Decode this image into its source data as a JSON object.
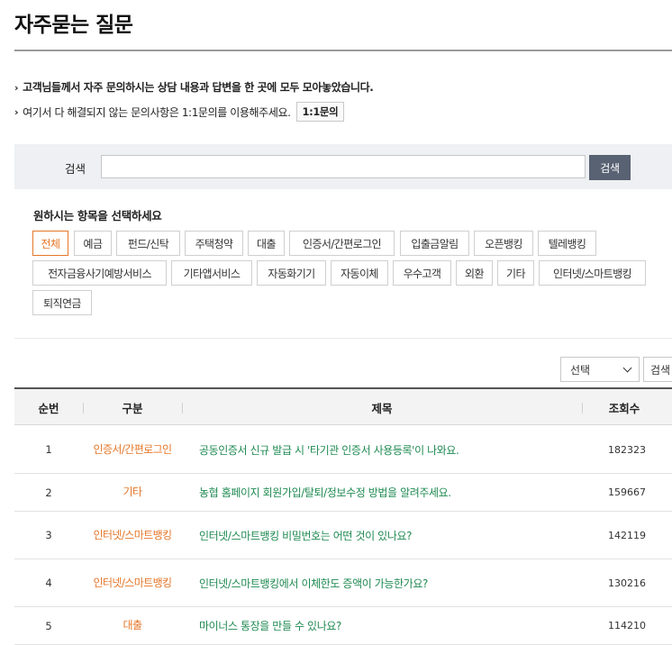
{
  "page": {
    "title": "자주묻는 질문"
  },
  "notices": [
    "고객님들께서 자주 문의하시는 상담 내용과 답변을 한 곳에 모두 모아놓았습니다.",
    "여기서 다 해결되지 않는 문의사항은 1:1문의를 이용해주세요."
  ],
  "inquiry_button": "1:1문의",
  "search": {
    "label": "검색",
    "value": "",
    "button": "검색"
  },
  "category_heading": "원하시는 항목을 선택하세요",
  "categories": [
    {
      "label": "전체",
      "active": true
    },
    {
      "label": "예금"
    },
    {
      "label": "펀드/신탁"
    },
    {
      "label": "주택청약"
    },
    {
      "label": "대출"
    },
    {
      "label": "인증서/간편로그인"
    },
    {
      "label": "입출금알림"
    },
    {
      "label": "오픈뱅킹"
    },
    {
      "label": "텔레뱅킹"
    },
    {
      "label": "전자금융사기예방서비스"
    },
    {
      "label": "기타앱서비스"
    },
    {
      "label": "자동화기기"
    },
    {
      "label": "자동이체"
    },
    {
      "label": "우수고객"
    },
    {
      "label": "외환"
    },
    {
      "label": "기타"
    },
    {
      "label": "인터넷/스마트뱅킹"
    },
    {
      "label": "퇴직연금"
    }
  ],
  "filter": {
    "select_value": "선택",
    "search_button": "검색"
  },
  "table": {
    "headers": {
      "num": "순번",
      "category": "구분",
      "title": "제목",
      "views": "조회수"
    },
    "rows": [
      {
        "num": "1",
        "category": "인증서/간편로그인",
        "title": "공동인증서 신규 발급 시 '타기관 인증서 사용등록'이 나와요.",
        "views": "182323"
      },
      {
        "num": "2",
        "category": "기타",
        "title": "농협 홈페이지 회원가입/탈퇴/정보수정 방법을 알려주세요.",
        "views": "159667"
      },
      {
        "num": "3",
        "category": "인터넷/스마트뱅킹",
        "title": "인터넷/스마트뱅킹 비밀번호는 어떤 것이 있나요?",
        "views": "142119"
      },
      {
        "num": "4",
        "category": "인터넷/스마트뱅킹",
        "title": "인터넷/스마트뱅킹에서 이체한도 증액이 가능한가요?",
        "views": "130216"
      },
      {
        "num": "5",
        "category": "대출",
        "title": "마이너스 통장을 만들 수 있나요?",
        "views": "114210"
      }
    ]
  },
  "colors": {
    "accent": "#e5772a",
    "title_link": "#1f8a52",
    "search_button": "#596273",
    "panel": "#eef0f3"
  }
}
